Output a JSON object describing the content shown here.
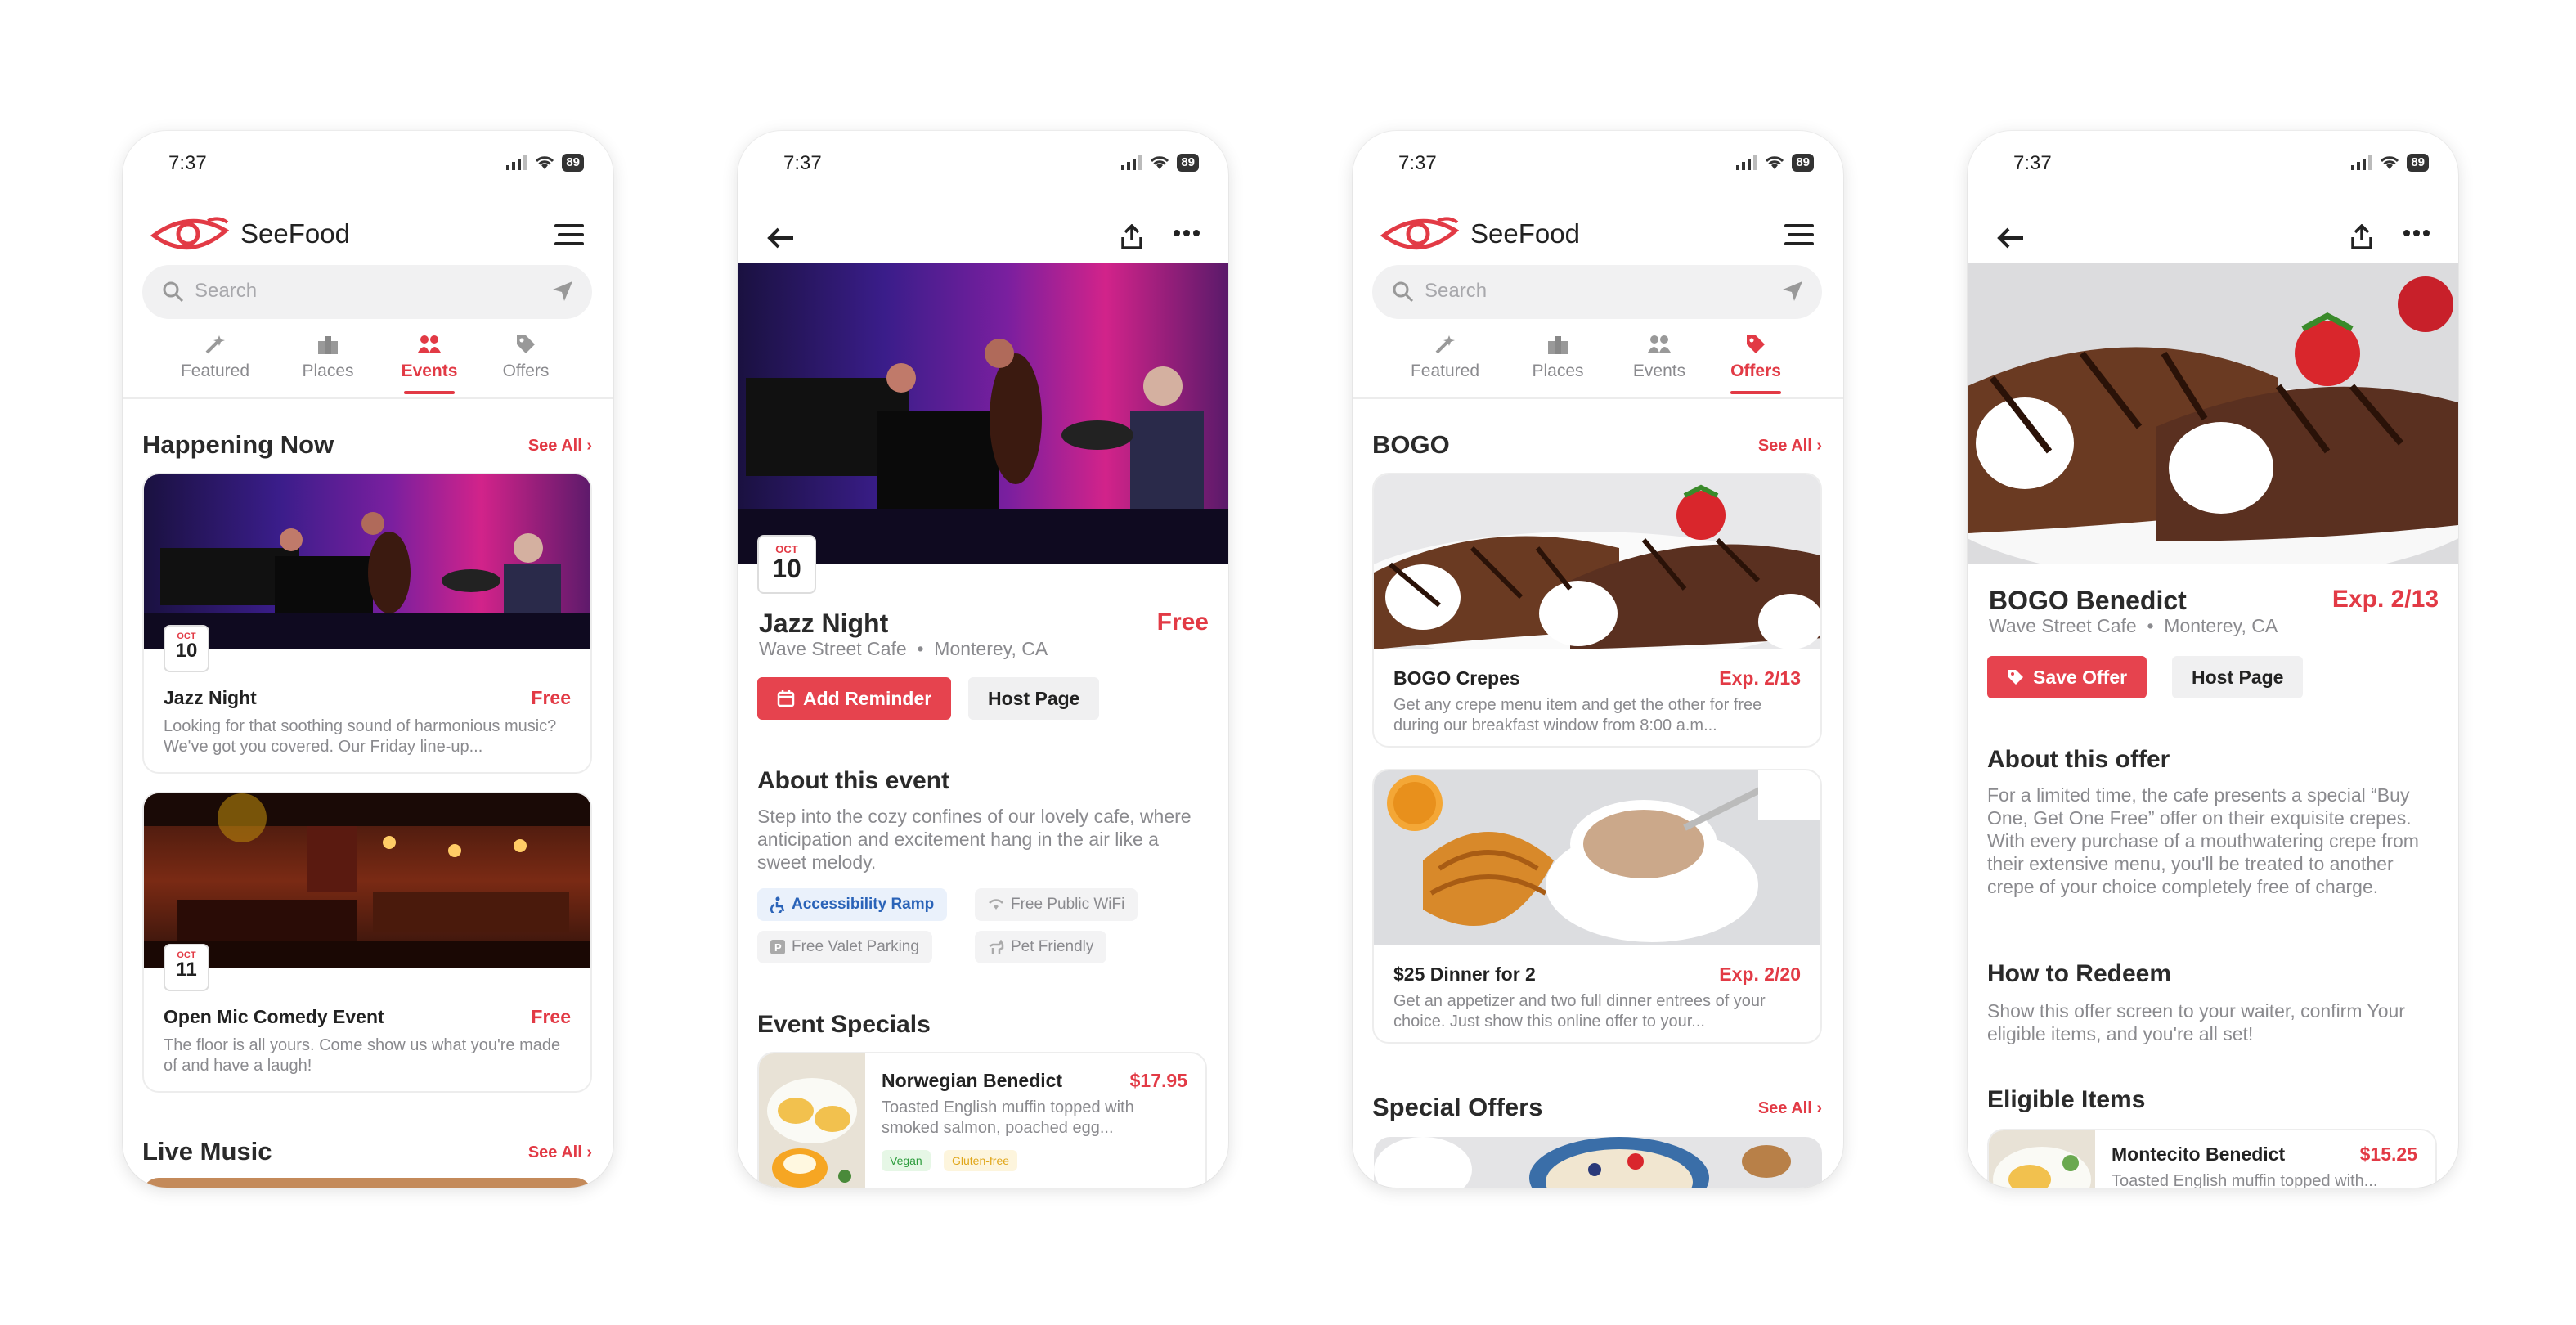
{
  "status": {
    "time": "7:37",
    "battery": "89"
  },
  "app": {
    "name": "SeeFood",
    "search_placeholder": "Search"
  },
  "tabs": [
    {
      "label": "Featured",
      "icon": "sparkle-icon"
    },
    {
      "label": "Places",
      "icon": "buildings-icon"
    },
    {
      "label": "Events",
      "icon": "people-icon"
    },
    {
      "label": "Offers",
      "icon": "tag-icon"
    }
  ],
  "screen1": {
    "active_tab": "Events",
    "section1": "Happening Now",
    "see_all": "See All",
    "events": [
      {
        "month": "OCT",
        "day": "10",
        "title": "Jazz Night",
        "price": "Free",
        "desc": "Looking for that soothing sound of harmonious music? We've got you covered. Our Friday line-up..."
      },
      {
        "month": "OCT",
        "day": "11",
        "title": "Open Mic Comedy Event",
        "price": "Free",
        "desc": "The floor is all yours. Come show us what you're made of and have a laugh!"
      }
    ],
    "section2": "Live Music"
  },
  "screen2": {
    "month": "OCT",
    "day": "10",
    "title": "Jazz Night",
    "venue": "Wave Street Cafe",
    "location": "Monterey, CA",
    "price": "Free",
    "reminder_btn": "Add Reminder",
    "host_btn": "Host Page",
    "about_title": "About this event",
    "about_text": "Step into the cozy confines of our lovely cafe, where anticipation and excitement hang in the air like a sweet melody.",
    "amenities": [
      {
        "label": "Accessibility Ramp",
        "icon": "wheelchair-icon",
        "highlight": true
      },
      {
        "label": "Free Public WiFi",
        "icon": "wifi-icon",
        "highlight": false
      },
      {
        "label": "Free Valet Parking",
        "icon": "parking-icon",
        "highlight": false
      },
      {
        "label": "Pet Friendly",
        "icon": "pet-icon",
        "highlight": false
      }
    ],
    "specials_title": "Event Specials",
    "special": {
      "title": "Norwegian Benedict",
      "price": "$17.95",
      "desc": "Toasted English muffin topped with smoked salmon, poached egg...",
      "tags": [
        "Vegan",
        "Gluten-free"
      ]
    }
  },
  "screen3": {
    "active_tab": "Offers",
    "section1": "BOGO",
    "see_all": "See All",
    "offers": [
      {
        "title": "BOGO Crepes",
        "exp": "Exp. 2/13",
        "desc": "Get any crepe menu item and get the other for free during our breakfast window from 8:00 a.m..."
      },
      {
        "title": "$25 Dinner for 2",
        "exp": "Exp. 2/20",
        "desc": "Get an appetizer and two full dinner entrees of your choice. Just show this online offer to your..."
      }
    ],
    "section2": "Special Offers"
  },
  "screen4": {
    "title": "BOGO Benedict",
    "venue": "Wave Street Cafe",
    "location": "Monterey, CA",
    "exp": "Exp. 2/13",
    "save_btn": "Save Offer",
    "host_btn": "Host Page",
    "about_title": "About this offer",
    "about_text": "For a limited time, the cafe presents a special “Buy One, Get One Free” offer on their exquisite crepes. With every purchase of a mouthwatering crepe from their extensive menu, you'll be treated to another crepe of your choice completely free of charge.",
    "redeem_title": "How to Redeem",
    "redeem_text": "Show this offer screen to your waiter, confirm Your eligible items, and you're all set!",
    "eligible_title": "Eligible Items",
    "item": {
      "title": "Montecito Benedict",
      "price": "$15.25",
      "desc": "Toasted English muffin topped with..."
    }
  },
  "colors": {
    "accent": "#e23a45",
    "text": "#2a2a2a",
    "muted": "#8a8a8e"
  }
}
